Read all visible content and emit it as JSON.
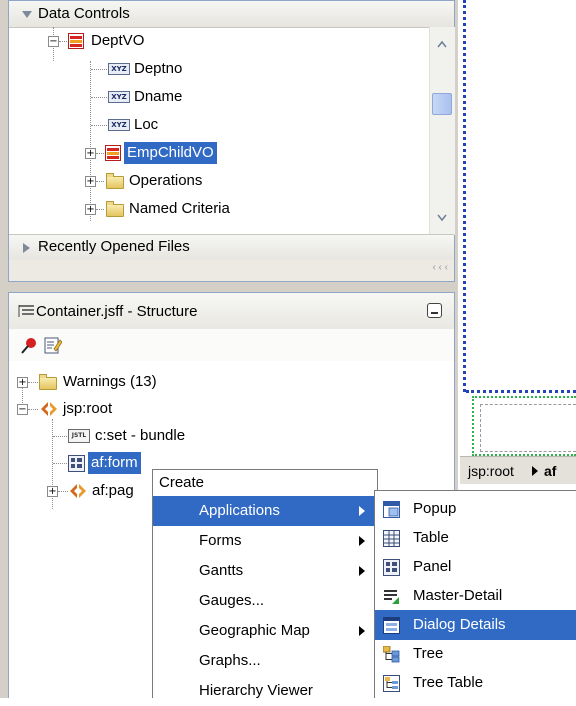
{
  "data_controls": {
    "title": "Data Controls",
    "tree": {
      "deptvo": "DeptVO",
      "deptno": "Deptno",
      "dname": "Dname",
      "loc": "Loc",
      "empchildvo": "EmpChildVO",
      "operations": "Operations",
      "named_criteria": "Named Criteria"
    },
    "xyz_badge": "XYZ",
    "recently_opened": "Recently Opened Files",
    "resize_grip": "‹ ‹ ‹"
  },
  "structure": {
    "title": "Container.jsff - Structure",
    "tree": {
      "warnings": "Warnings (13)",
      "jsp_root": "jsp:root",
      "cset": "c:set - bundle",
      "af_form": "af:form",
      "af_page_partial": "af:pag"
    },
    "jstl_badge": "JSTL"
  },
  "design": {
    "breadcrumb_root": "jsp:root",
    "breadcrumb_next": "af"
  },
  "context_menu": {
    "header": "Create",
    "items": [
      {
        "label": "Applications",
        "submenu": true
      },
      {
        "label": "Forms",
        "submenu": true
      },
      {
        "label": "Gantts",
        "submenu": true
      },
      {
        "label": "Gauges...",
        "submenu": false
      },
      {
        "label": "Geographic Map",
        "submenu": true
      },
      {
        "label": "Graphs...",
        "submenu": false
      },
      {
        "label": "Hierarchy Viewer",
        "submenu": false
      }
    ]
  },
  "submenu": {
    "items": [
      {
        "label": "Popup",
        "icon": "popup-icon"
      },
      {
        "label": "Table",
        "icon": "table-icon"
      },
      {
        "label": "Panel",
        "icon": "panel-icon"
      },
      {
        "label": "Master-Detail",
        "icon": "master-detail-icon"
      },
      {
        "label": "Dialog Details",
        "icon": "dialog-details-icon"
      },
      {
        "label": "Tree",
        "icon": "tree-icon"
      },
      {
        "label": "Tree Table",
        "icon": "tree-table-icon"
      }
    ]
  },
  "colors": {
    "selection": "#316ac5",
    "panel_border": "#8fa6c6",
    "design_dash": "#2343b7"
  }
}
